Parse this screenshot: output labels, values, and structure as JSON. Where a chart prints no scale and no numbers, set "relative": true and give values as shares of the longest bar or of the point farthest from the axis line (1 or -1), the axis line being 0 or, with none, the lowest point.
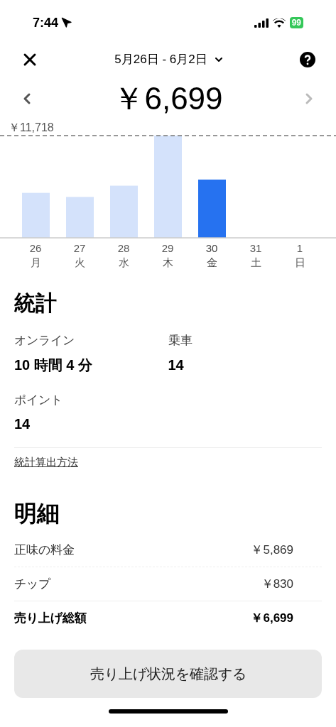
{
  "status_bar": {
    "time": "7:44",
    "battery": "99"
  },
  "header": {
    "date_range": "5月26日 - 6月2日"
  },
  "total": {
    "amount": "￥6,699"
  },
  "chart": {
    "days": [
      {
        "weekday": "月",
        "selected": false
      },
      {
        "weekday": "火",
        "selected": false
      },
      {
        "weekday": "水",
        "selected": false
      },
      {
        "weekday": "木",
        "selected": false
      },
      {
        "weekday": "金",
        "selected": true
      },
      {
        "weekday": "土",
        "selected": false
      },
      {
        "weekday": "日",
        "selected": false
      }
    ],
    "chart_data": {
      "type": "bar",
      "relative": true,
      "categories": [
        "26",
        "27",
        "28",
        "29",
        "30",
        "31",
        "1"
      ],
      "annotations": [
        {
          "text": "￥11,718"
        }
      ],
      "series": [
        {
          "values": [
            0.44,
            0.4,
            0.51,
            1,
            0.57,
            0,
            0
          ]
        }
      ]
    }
  },
  "stats": {
    "title": "統計",
    "items": [
      {
        "label": "オンライン",
        "value": "10 時間 4 分"
      },
      {
        "label": "乗車",
        "value": "14"
      },
      {
        "label": "ポイント",
        "value": "14"
      }
    ],
    "link": "統計算出方法"
  },
  "breakdown": {
    "title": "明細",
    "rows": [
      {
        "label": "正味の料金",
        "value": "￥5,869",
        "kind": "normal"
      },
      {
        "label": "チップ",
        "value": "￥830",
        "kind": "normal"
      },
      {
        "label": "売り上げ総額",
        "value": "￥6,699",
        "kind": "total"
      }
    ]
  },
  "button": "売り上げ状況を確認する"
}
